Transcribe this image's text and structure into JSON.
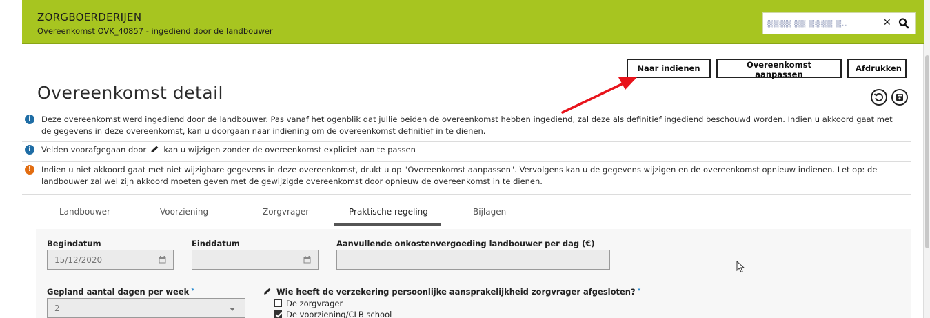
{
  "header": {
    "app_title": "ZORGBOERDERIJEN",
    "subtitle": "Overeenkomst OVK_40857 - ingediend door de landbouwer",
    "search_value": "▒▒▒▒ ▒▒ ▒▒▒▒ ▒.."
  },
  "toolbar": {
    "submit_label": "Naar indienen",
    "adjust_label": "Overeenkomst aanpassen",
    "print_label": "Afdrukken"
  },
  "page": {
    "title": "Overeenkomst detail"
  },
  "notices": {
    "info1": "Deze overeenkomst werd ingediend door de landbouwer. Pas vanaf het ogenblik dat jullie beiden de overeenkomst hebben ingediend, zal deze als definitief ingediend beschouwd worden. Indien u akkoord gaat met de gegevens in deze overeenkomst, kan u doorgaan naar indiening om de overeenkomst definitief in te dienen.",
    "info2_before": "Velden voorafgegaan door",
    "info2_after": "kan u wijzigen zonder de overeenkomst expliciet aan te passen",
    "warn": "Indien u niet akkoord gaat met niet wijzigbare gegevens in deze overeenkomst, drukt u op \"Overeenkomst aanpassen\". Vervolgens kan u de gegevens wijzigen en de overeenkomst opnieuw indienen. Let op: de landbouwer zal wel zijn akkoord moeten geven met de gewijzigde overeenkomst door opnieuw de overeenkomst in te dienen."
  },
  "tabs": [
    "Landbouwer",
    "Voorziening",
    "Zorgvrager",
    "Praktische regeling",
    "Bijlagen"
  ],
  "active_tab": "Praktische regeling",
  "form": {
    "begin_label": "Begindatum",
    "begin_value": "15/12/2020",
    "end_label": "Einddatum",
    "end_value": "",
    "cost_label": "Aanvullende onkostenvergoeding landbouwer per dag (€)",
    "cost_value": "",
    "days_label": "Gepland aantal dagen per week",
    "days_value": "2",
    "insurance_label": "Wie heeft de verzekering persoonlijke aansprakelijkheid zorgvrager afgesloten?",
    "insurance_options": [
      {
        "label": "De zorgvrager",
        "checked": false
      },
      {
        "label": "De voorziening/CLB school",
        "checked": true
      }
    ],
    "required_marker": "*"
  },
  "colors": {
    "header_green": "#a7c520",
    "info_blue": "#1f6da5",
    "warn_orange": "#e26d11",
    "annotation_red": "#e8131b"
  }
}
